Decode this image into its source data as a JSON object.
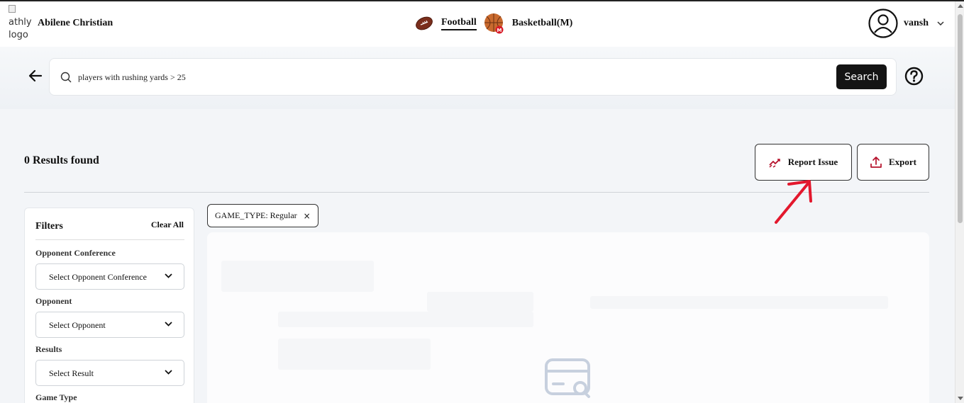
{
  "header": {
    "logo_alt": "athly logo",
    "org_name": "Abilene Christian",
    "sports": [
      {
        "label": "Football",
        "active": true,
        "icon": "football-icon"
      },
      {
        "label": "Basketball(M)",
        "active": false,
        "icon": "basketball-icon"
      }
    ],
    "user": {
      "name": "vansh",
      "icon": "user-avatar-icon"
    }
  },
  "search": {
    "value": "players with rushing yards > 25",
    "button_label": "Search"
  },
  "results": {
    "count_text": "0 Results found",
    "report_label": "Report Issue",
    "export_label": "Export"
  },
  "filters": {
    "title": "Filters",
    "clear_label": "Clear All",
    "groups": [
      {
        "label": "Opponent Conference",
        "placeholder": "Select Opponent Conference"
      },
      {
        "label": "Opponent",
        "placeholder": "Select Opponent"
      },
      {
        "label": "Results",
        "placeholder": "Select Result"
      },
      {
        "label": "Game Type"
      }
    ]
  },
  "active_chips": [
    {
      "label": "GAME_TYPE: Regular",
      "remove": "×"
    }
  ],
  "colors": {
    "accent": "#141414",
    "annotation": "#e3182d",
    "report_icon": "#b5102a",
    "sport_football": "#7a2e1c",
    "sport_basketball": "#c96a2e"
  }
}
